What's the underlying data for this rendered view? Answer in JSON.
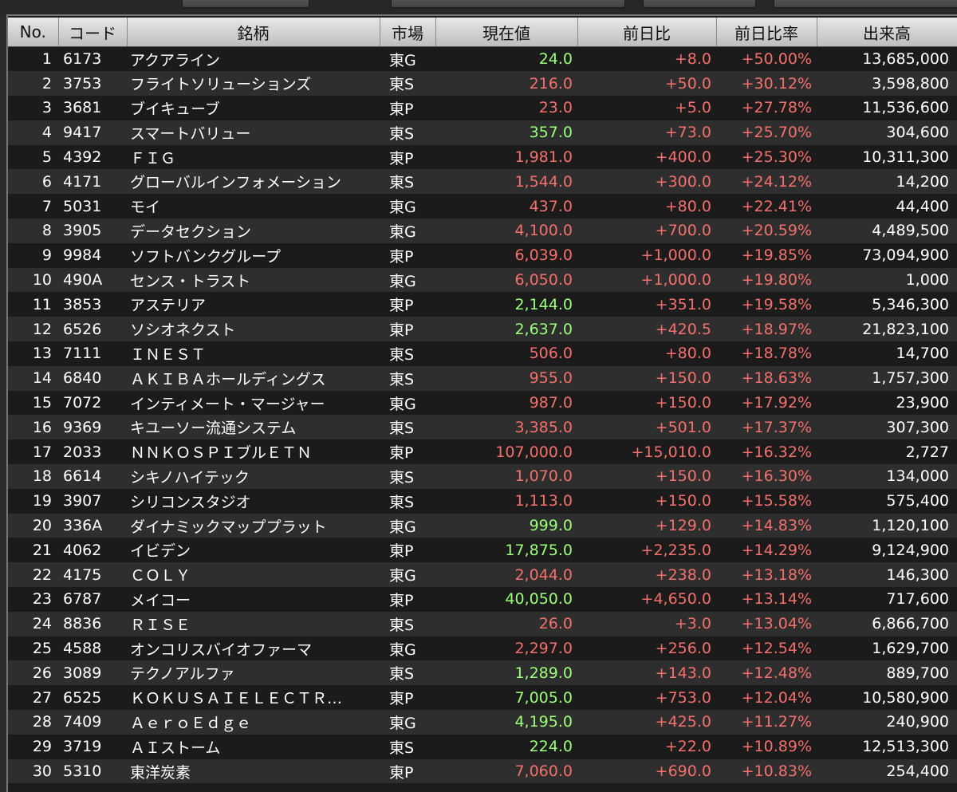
{
  "colors": {
    "price_up_green": "#9cff7a",
    "price_up_red": "#f4706c",
    "change_color": "#f4706c",
    "header_bg": "#d4d4d4"
  },
  "headers": {
    "no": "No.",
    "code": "コード",
    "name": "銘柄",
    "market": "市場",
    "price": "現在値",
    "change": "前日比",
    "change_pct": "前日比率",
    "volume": "出来高"
  },
  "rows": [
    {
      "no": "1",
      "code": "6173",
      "name": "アクアライン",
      "market": "東G",
      "price": "24.0",
      "price_color": "green",
      "change": "+8.0",
      "change_pct": "+50.00%",
      "volume": "13,685,000"
    },
    {
      "no": "2",
      "code": "3753",
      "name": "フライトソリューションズ",
      "market": "東S",
      "price": "216.0",
      "price_color": "red",
      "change": "+50.0",
      "change_pct": "+30.12%",
      "volume": "3,598,800"
    },
    {
      "no": "3",
      "code": "3681",
      "name": "ブイキューブ",
      "market": "東P",
      "price": "23.0",
      "price_color": "red",
      "change": "+5.0",
      "change_pct": "+27.78%",
      "volume": "11,536,600"
    },
    {
      "no": "4",
      "code": "9417",
      "name": "スマートバリュー",
      "market": "東S",
      "price": "357.0",
      "price_color": "green",
      "change": "+73.0",
      "change_pct": "+25.70%",
      "volume": "304,600"
    },
    {
      "no": "5",
      "code": "4392",
      "name": "ＦＩＧ",
      "market": "東P",
      "price": "1,981.0",
      "price_color": "red",
      "change": "+400.0",
      "change_pct": "+25.30%",
      "volume": "10,311,300"
    },
    {
      "no": "6",
      "code": "4171",
      "name": "グローバルインフォメーション",
      "market": "東S",
      "price": "1,544.0",
      "price_color": "red",
      "change": "+300.0",
      "change_pct": "+24.12%",
      "volume": "14,200"
    },
    {
      "no": "7",
      "code": "5031",
      "name": "モイ",
      "market": "東G",
      "price": "437.0",
      "price_color": "red",
      "change": "+80.0",
      "change_pct": "+22.41%",
      "volume": "44,400"
    },
    {
      "no": "8",
      "code": "3905",
      "name": "データセクション",
      "market": "東G",
      "price": "4,100.0",
      "price_color": "red",
      "change": "+700.0",
      "change_pct": "+20.59%",
      "volume": "4,489,500"
    },
    {
      "no": "9",
      "code": "9984",
      "name": "ソフトバンクグループ",
      "market": "東P",
      "price": "6,039.0",
      "price_color": "red",
      "change": "+1,000.0",
      "change_pct": "+19.85%",
      "volume": "73,094,900"
    },
    {
      "no": "10",
      "code": "490A",
      "name": "センス・トラスト",
      "market": "東G",
      "price": "6,050.0",
      "price_color": "red",
      "change": "+1,000.0",
      "change_pct": "+19.80%",
      "volume": "1,000"
    },
    {
      "no": "11",
      "code": "3853",
      "name": "アステリア",
      "market": "東P",
      "price": "2,144.0",
      "price_color": "green",
      "change": "+351.0",
      "change_pct": "+19.58%",
      "volume": "5,346,300"
    },
    {
      "no": "12",
      "code": "6526",
      "name": "ソシオネクスト",
      "market": "東P",
      "price": "2,637.0",
      "price_color": "green",
      "change": "+420.5",
      "change_pct": "+18.97%",
      "volume": "21,823,100"
    },
    {
      "no": "13",
      "code": "7111",
      "name": "ＩＮＥＳＴ",
      "market": "東S",
      "price": "506.0",
      "price_color": "red",
      "change": "+80.0",
      "change_pct": "+18.78%",
      "volume": "14,700"
    },
    {
      "no": "14",
      "code": "6840",
      "name": "ＡＫＩＢＡホールディングス",
      "market": "東S",
      "price": "955.0",
      "price_color": "red",
      "change": "+150.0",
      "change_pct": "+18.63%",
      "volume": "1,757,300"
    },
    {
      "no": "15",
      "code": "7072",
      "name": "インティメート・マージャー",
      "market": "東G",
      "price": "987.0",
      "price_color": "red",
      "change": "+150.0",
      "change_pct": "+17.92%",
      "volume": "23,900"
    },
    {
      "no": "16",
      "code": "9369",
      "name": "キユーソー流通システム",
      "market": "東S",
      "price": "3,385.0",
      "price_color": "red",
      "change": "+501.0",
      "change_pct": "+17.37%",
      "volume": "307,300"
    },
    {
      "no": "17",
      "code": "2033",
      "name": "ＮＮＫＯＳＰＩブルＥＴＮ",
      "market": "東P",
      "price": "107,000.0",
      "price_color": "red",
      "change": "+15,010.0",
      "change_pct": "+16.32%",
      "volume": "2,727"
    },
    {
      "no": "18",
      "code": "6614",
      "name": "シキノハイテック",
      "market": "東S",
      "price": "1,070.0",
      "price_color": "red",
      "change": "+150.0",
      "change_pct": "+16.30%",
      "volume": "134,000"
    },
    {
      "no": "19",
      "code": "3907",
      "name": "シリコンスタジオ",
      "market": "東S",
      "price": "1,113.0",
      "price_color": "red",
      "change": "+150.0",
      "change_pct": "+15.58%",
      "volume": "575,400"
    },
    {
      "no": "20",
      "code": "336A",
      "name": "ダイナミックマッププラット",
      "market": "東G",
      "price": "999.0",
      "price_color": "green",
      "change": "+129.0",
      "change_pct": "+14.83%",
      "volume": "1,120,100"
    },
    {
      "no": "21",
      "code": "4062",
      "name": "イビデン",
      "market": "東P",
      "price": "17,875.0",
      "price_color": "green",
      "change": "+2,235.0",
      "change_pct": "+14.29%",
      "volume": "9,124,900"
    },
    {
      "no": "22",
      "code": "4175",
      "name": "ＣＯＬＹ",
      "market": "東G",
      "price": "2,044.0",
      "price_color": "red",
      "change": "+238.0",
      "change_pct": "+13.18%",
      "volume": "146,300"
    },
    {
      "no": "23",
      "code": "6787",
      "name": "メイコー",
      "market": "東P",
      "price": "40,050.0",
      "price_color": "green",
      "change": "+4,650.0",
      "change_pct": "+13.14%",
      "volume": "717,600"
    },
    {
      "no": "24",
      "code": "8836",
      "name": "ＲＩＳＥ",
      "market": "東S",
      "price": "26.0",
      "price_color": "red",
      "change": "+3.0",
      "change_pct": "+13.04%",
      "volume": "6,866,700"
    },
    {
      "no": "25",
      "code": "4588",
      "name": "オンコリスバイオファーマ",
      "market": "東G",
      "price": "2,297.0",
      "price_color": "red",
      "change": "+256.0",
      "change_pct": "+12.54%",
      "volume": "1,629,700"
    },
    {
      "no": "26",
      "code": "3089",
      "name": "テクノアルファ",
      "market": "東S",
      "price": "1,289.0",
      "price_color": "green",
      "change": "+143.0",
      "change_pct": "+12.48%",
      "volume": "889,700"
    },
    {
      "no": "27",
      "code": "6525",
      "name": "ＫＯＫＵＳＡＩＥＬＥＣＴＲ…",
      "market": "東P",
      "price": "7,005.0",
      "price_color": "green",
      "change": "+753.0",
      "change_pct": "+12.04%",
      "volume": "10,580,900"
    },
    {
      "no": "28",
      "code": "7409",
      "name": "ＡｅｒｏＥｄｇｅ",
      "market": "東G",
      "price": "4,195.0",
      "price_color": "green",
      "change": "+425.0",
      "change_pct": "+11.27%",
      "volume": "240,900"
    },
    {
      "no": "29",
      "code": "3719",
      "name": "ＡＩストーム",
      "market": "東S",
      "price": "224.0",
      "price_color": "green",
      "change": "+22.0",
      "change_pct": "+10.89%",
      "volume": "12,513,300"
    },
    {
      "no": "30",
      "code": "5310",
      "name": "東洋炭素",
      "market": "東P",
      "price": "7,060.0",
      "price_color": "red",
      "change": "+690.0",
      "change_pct": "+10.83%",
      "volume": "254,400"
    }
  ]
}
